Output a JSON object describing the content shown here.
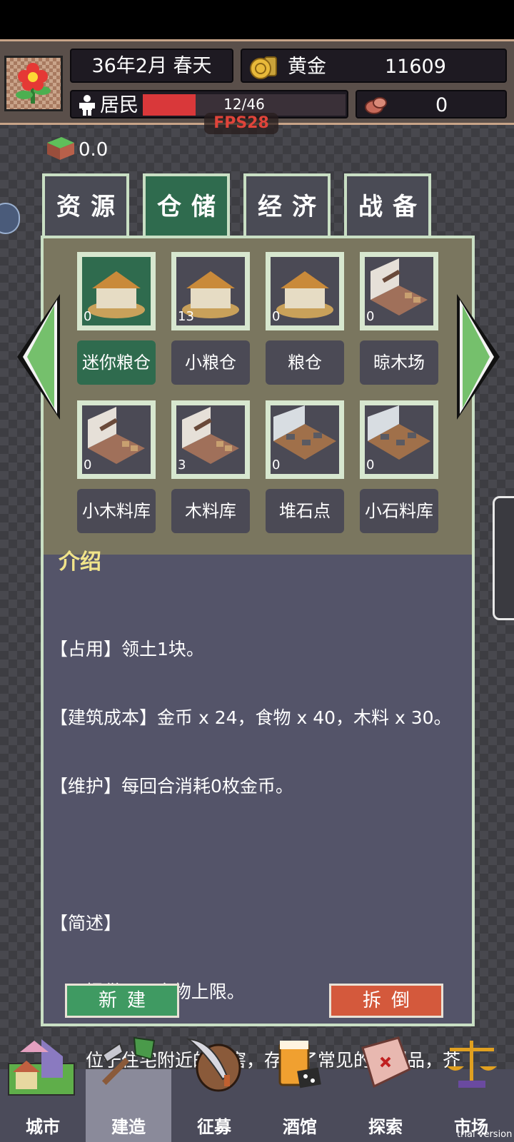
{
  "header": {
    "date": "36年2月 春天",
    "gold_label": "黄金",
    "gold_value": "11609",
    "resident_label": "居民",
    "resident_count": "12/46",
    "resident_fraction": 0.26,
    "meat_value": "0",
    "fps": "FPS28",
    "land_value": "0.0"
  },
  "tabs": [
    {
      "label": "资源"
    },
    {
      "label": "仓储"
    },
    {
      "label": "经济"
    },
    {
      "label": "战备"
    }
  ],
  "buildings": [
    {
      "name": "迷你粮仓",
      "count": "0",
      "icon": "granary-icon"
    },
    {
      "name": "小粮仓",
      "count": "13",
      "icon": "granary-icon"
    },
    {
      "name": "粮仓",
      "count": "0",
      "icon": "granary-icon"
    },
    {
      "name": "晾木场",
      "count": "0",
      "icon": "lumber-yard-icon"
    },
    {
      "name": "小木料库",
      "count": "0",
      "icon": "lumber-yard-icon"
    },
    {
      "name": "木料库",
      "count": "3",
      "icon": "lumber-yard-icon"
    },
    {
      "name": "堆石点",
      "count": "0",
      "icon": "stone-yard-icon"
    },
    {
      "name": "小石料库",
      "count": "0",
      "icon": "stone-yard-icon"
    }
  ],
  "intro": {
    "title": "介绍",
    "occupy": "【占用】领土1块。",
    "cost": "【建筑成本】金币 x 24，食物 x 40，木料 x 30。",
    "upkeep": "【维护】每回合消耗0枚金币。",
    "summary_title": "【简述】",
    "summary_1": "　　提供150食物上限。",
    "summary_2": "　　位于住宅附近的地窖，存放了常见的腌制品，芥咸菜、咸鸭蛋、萝卜和白菜等，是寻常人家过冬的必备建筑。"
  },
  "actions": {
    "build": "新建",
    "demolish": "拆倒"
  },
  "nav": [
    {
      "label": "城市"
    },
    {
      "label": "建造"
    },
    {
      "label": "征募"
    },
    {
      "label": "酒馆"
    },
    {
      "label": "探索"
    },
    {
      "label": "市场"
    }
  ],
  "watermark": "trial version",
  "colors": {
    "accent_green": "#2f6b4e",
    "demolish_red": "#d4593c",
    "build_green": "#3f9a62"
  }
}
